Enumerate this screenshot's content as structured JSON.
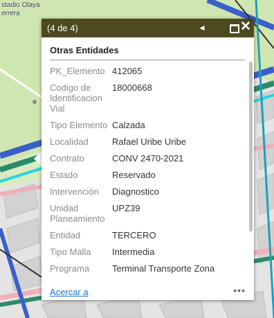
{
  "map": {
    "labels": [
      "stadio Olaya",
      "errera"
    ]
  },
  "popup": {
    "header": {
      "count_text": "(4 de 4)",
      "prev_icon": "◄",
      "close_icon": "✕"
    },
    "title": "Otras Entidades",
    "fields": [
      {
        "name": "PK_Elemento",
        "value": "412065"
      },
      {
        "name": "Codigo de Identificacion Vial",
        "value": "18000668"
      },
      {
        "name": "Tipo Elemento",
        "value": "Calzada"
      },
      {
        "name": "Localidad",
        "value": "Rafael Uribe Uribe"
      },
      {
        "name": "Contrato",
        "value": "CONV 2470-2021"
      },
      {
        "name": "Estado",
        "value": "Reservado"
      },
      {
        "name": "Intervención",
        "value": "Diagnostico"
      },
      {
        "name": "Unidad Planeamiento",
        "value": "UPZ39"
      },
      {
        "name": "Entidad",
        "value": "TERCERO"
      },
      {
        "name": "Tipo Malla",
        "value": "Intermedia"
      },
      {
        "name": "Programa",
        "value": "Terminal Transporte Zona"
      }
    ],
    "footer": {
      "zoom_label": "Acercar a",
      "more_icon": "•••"
    }
  },
  "colors": {
    "header_bg": "#4c4a1e",
    "map_green": "#cfe6b0",
    "road_cyan": "#25d4e0",
    "road_blue": "#3a5fc8",
    "road_pink": "#f0b0b8",
    "road_teal": "#2a8a6a"
  }
}
